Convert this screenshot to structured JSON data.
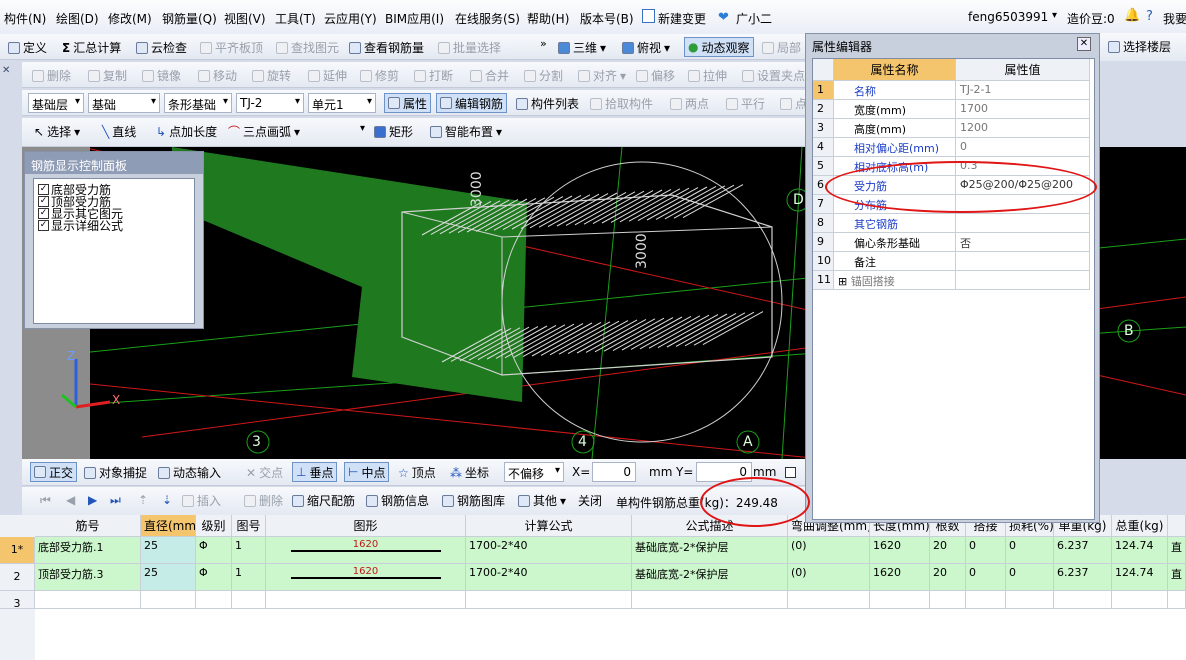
{
  "menu": [
    "构件(N)",
    "绘图(D)",
    "修改(M)",
    "钢筋量(Q)",
    "视图(V)",
    "工具(T)",
    "云应用(Y)",
    "BIM应用(I)",
    "在线服务(S)",
    "帮助(H)",
    "版本号(B)",
    "新建变更",
    "广小二"
  ],
  "user": {
    "name": "feng6503991",
    "coins": "造价豆:0",
    "ask": "我要"
  },
  "toolbar1": [
    "定义",
    "汇总计算",
    "云检查",
    "平齐板顶",
    "查找图元",
    "查看钢筋量",
    "批量选择",
    "三维",
    "俯视",
    "动态观察",
    "局部"
  ],
  "toolbar2": [
    "删除",
    "复制",
    "镜像",
    "移动",
    "旋转",
    "延伸",
    "修剪",
    "打断",
    "合并",
    "分割",
    "对齐",
    "偏移",
    "拉伸",
    "设置夹点"
  ],
  "toolbar3": {
    "combos": [
      "基础层",
      "基础",
      "条形基础",
      "TJ-2",
      "单元1"
    ],
    "buttons": [
      "属性",
      "编辑钢筋",
      "构件列表",
      "拾取构件",
      "两点",
      "平行",
      "点"
    ]
  },
  "toolbar4": [
    "选择",
    "直线",
    "点加长度",
    "三点画弧",
    "矩形",
    "智能布置"
  ],
  "right_toolbar": {
    "label": "选择楼层"
  },
  "rebar_panel": {
    "title": "钢筋显示控制面板",
    "items": [
      "底部受力筋",
      "顶部受力筋",
      "显示其它图元",
      "显示详细公式"
    ]
  },
  "viewport": {
    "dim_labels": [
      "3000",
      "3000"
    ],
    "axis_labels": [
      "3",
      "4",
      "A",
      "B",
      "D"
    ],
    "axes": [
      "Z",
      "X"
    ]
  },
  "snapbar": {
    "buttons": [
      "正交",
      "对象捕捉",
      "动态输入",
      "交点",
      "垂点",
      "中点",
      "顶点",
      "坐标"
    ],
    "offset_mode": "不偏移",
    "x_label": "X=",
    "x_value": "0",
    "unit1": "mm",
    "y_label": "Y=",
    "y_value": "0",
    "unit2": "mm"
  },
  "tablebar": {
    "buttons": [
      "插入",
      "删除",
      "缩尺配筋",
      "钢筋信息",
      "钢筋图库",
      "其他",
      "关闭"
    ],
    "total_label": "单构件钢筋总重(kg)：249.48"
  },
  "grid": {
    "headers": [
      "筋号",
      "直径(mm)",
      "级别",
      "图号",
      "图形",
      "计算公式",
      "公式描述",
      "弯曲调整(mm)",
      "长度(mm)",
      "根数",
      "搭接",
      "损耗(%)",
      "单重(kg)",
      "总重(kg)",
      ""
    ],
    "rows": [
      {
        "num": "1*",
        "cells": [
          "底部受力筋.1",
          "25",
          "Φ",
          "1",
          "1620",
          "1700-2*40",
          "基础底宽-2*保护层",
          "(0)",
          "1620",
          "20",
          "0",
          "0",
          "6.237",
          "124.74",
          "直"
        ]
      },
      {
        "num": "2",
        "cells": [
          "顶部受力筋.3",
          "25",
          "Φ",
          "1",
          "1620",
          "1700-2*40",
          "基础底宽-2*保护层",
          "(0)",
          "1620",
          "20",
          "0",
          "0",
          "6.237",
          "124.74",
          "直"
        ]
      },
      {
        "num": "3",
        "cells": [
          "",
          "",
          "",
          "",
          "",
          "",
          "",
          "",
          "",
          "",
          "",
          "",
          "",
          "",
          ""
        ]
      }
    ]
  },
  "prop_editor": {
    "title": "属性编辑器",
    "col_name": "属性名称",
    "col_value": "属性值",
    "rows": [
      {
        "num": "1",
        "name": "名称",
        "value": "TJ-2-1"
      },
      {
        "num": "2",
        "name": "宽度(mm)",
        "value": "1700"
      },
      {
        "num": "3",
        "name": "高度(mm)",
        "value": "1200"
      },
      {
        "num": "4",
        "name": "相对偏心距(mm)",
        "value": "0"
      },
      {
        "num": "5",
        "name": "相对底标高(m)",
        "value": "0.3"
      },
      {
        "num": "6",
        "name": "受力筋",
        "value": "Φ25@200/Φ25@200"
      },
      {
        "num": "7",
        "name": "分布筋",
        "value": ""
      },
      {
        "num": "8",
        "name": "其它钢筋",
        "value": ""
      },
      {
        "num": "9",
        "name": "偏心条形基础",
        "value": "否"
      },
      {
        "num": "10",
        "name": "备注",
        "value": ""
      },
      {
        "num": "11",
        "name": "锚固搭接",
        "value": ""
      }
    ]
  },
  "colors": {
    "header_accent": "#f5c56e",
    "grid_green": "#ccf7cc",
    "annotation_red": "#e01515",
    "viewport_bg": "#000000"
  }
}
